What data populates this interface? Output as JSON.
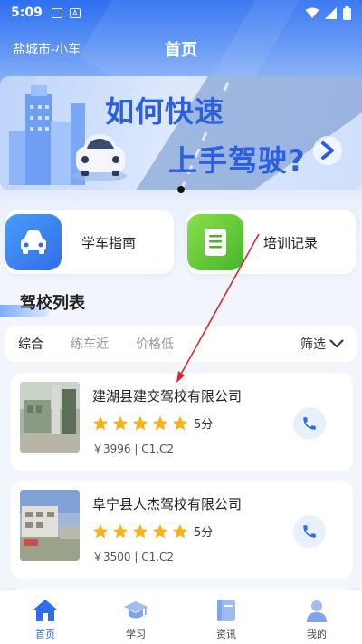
{
  "status_bar": {
    "time": "5:09"
  },
  "nav": {
    "city": "盐城市-小车",
    "title": "首页"
  },
  "banner": {
    "line1": "如何快速",
    "line2": "上手驾驶?"
  },
  "quick_links": [
    {
      "label": "学车指南",
      "icon": "car-icon"
    },
    {
      "label": "培训记录",
      "icon": "document-icon"
    }
  ],
  "section": {
    "title": "驾校列表"
  },
  "filters": {
    "items": [
      "综合",
      "练车近",
      "价格低"
    ],
    "screen_label": "筛选"
  },
  "schools": [
    {
      "name": "建湖县建交驾校有限公司",
      "rating": 5,
      "score_label": "5分",
      "meta": "￥3996 | C1,C2"
    },
    {
      "name": "阜宁县人杰驾校有限公司",
      "rating": 5,
      "score_label": "5分",
      "meta": "￥3500 | C1,C2"
    }
  ],
  "tabbar": [
    {
      "label": "首页",
      "icon": "home-icon"
    },
    {
      "label": "学习",
      "icon": "graduation-cap-icon"
    },
    {
      "label": "资讯",
      "icon": "book-icon"
    },
    {
      "label": "我的",
      "icon": "user-icon"
    }
  ],
  "colors": {
    "primary": "#2f6ee8",
    "star": "#f6b21b",
    "annotation": "#d9262a"
  }
}
